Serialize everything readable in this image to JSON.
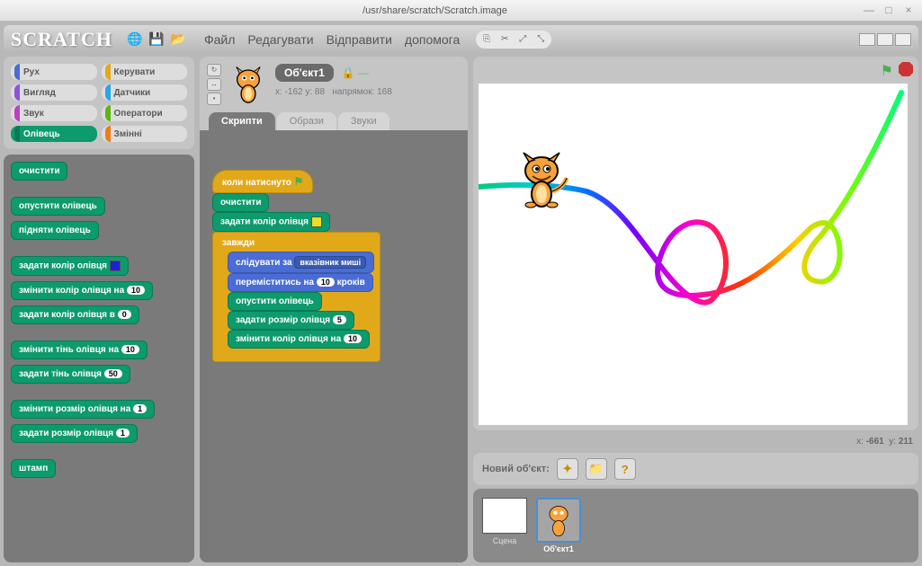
{
  "window": {
    "title": "/usr/share/scratch/Scratch.image"
  },
  "logo": "SCRATCH",
  "menu": {
    "file": "Файл",
    "edit": "Редагувати",
    "share": "Відправити",
    "help": "допомога"
  },
  "categories": {
    "motion": "Рух",
    "control": "Керувати",
    "looks": "Вигляд",
    "sensing": "Датчики",
    "sound": "Звук",
    "operators": "Оператори",
    "pen": "Олівець",
    "variables": "Змінні"
  },
  "palette_blocks": {
    "clear": "очистити",
    "pen_down": "опустити олівець",
    "pen_up": "підняти олівець",
    "set_color": "задати колір олівця",
    "change_color_by": "змінити колір олівця на",
    "change_color_by_val": "10",
    "set_color_to": "задати колір олівця в",
    "set_color_to_val": "0",
    "change_shade_by": "змінити тінь олівця на",
    "change_shade_by_val": "10",
    "set_shade": "задати тінь олівця",
    "set_shade_val": "50",
    "change_size_by": "змінити розмір олівця на",
    "change_size_by_val": "1",
    "set_size": "задати розмір олівця",
    "set_size_val": "1",
    "stamp": "штамп"
  },
  "sprite": {
    "name": "Об'єкт1",
    "x_label": "x:",
    "x": "-162",
    "y_label": "y:",
    "y": "88",
    "dir_label": "напрямок:",
    "dir": "168"
  },
  "tabs": {
    "scripts": "Скрипти",
    "costumes": "Образи",
    "sounds": "Звуки"
  },
  "script": {
    "hat": "коли натиснуто",
    "clear": "очистити",
    "set_color": "задати колір олівця",
    "forever": "завжди",
    "point_towards": "слідувати за",
    "point_towards_val": "вказівник миші",
    "move": "переміститись на",
    "move_val": "10",
    "move_suffix": "кроків",
    "pen_down": "опустити олівець",
    "set_size": "задати розмір олівця",
    "set_size_val": "5",
    "change_color": "змінити колір олівця на",
    "change_color_val": "10"
  },
  "stage_coords": {
    "x_label": "x:",
    "x": "-661",
    "y_label": "y:",
    "y": "211"
  },
  "new_sprite": {
    "label": "Новий об'єкт:"
  },
  "stage_thumb": {
    "label": "Сцена"
  },
  "sprite_item": {
    "label": "Об'єкт1"
  }
}
